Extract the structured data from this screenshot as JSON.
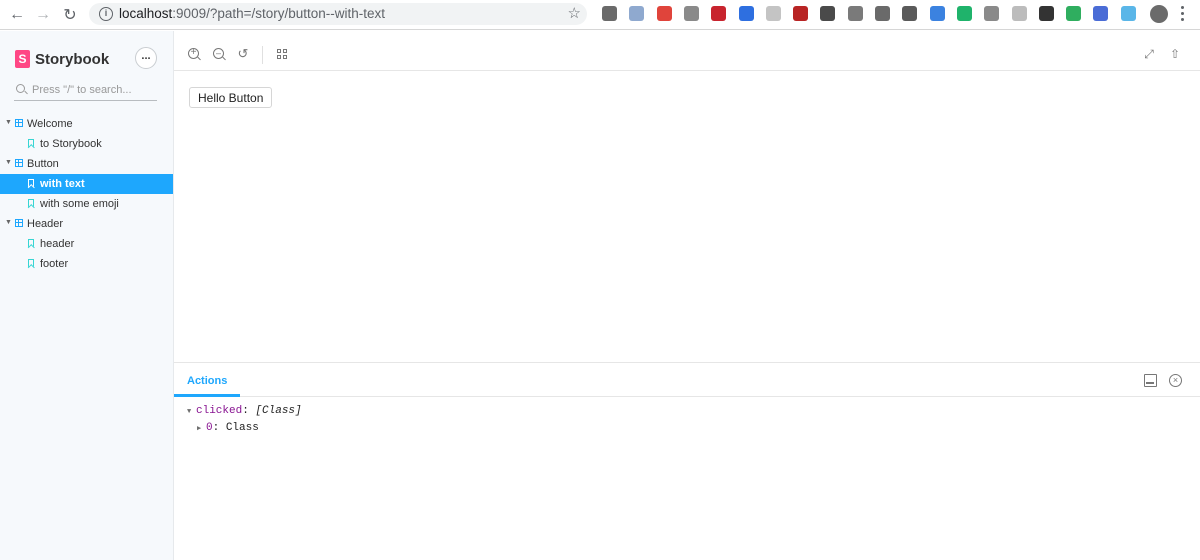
{
  "browser": {
    "url_host": "localhost",
    "url_rest": ":9009/?path=/story/button--with-text",
    "extensions": [
      {
        "name": "ext-1",
        "color": "#6a6a6a"
      },
      {
        "name": "ext-2",
        "color": "#8fa9cf"
      },
      {
        "name": "ext-3",
        "color": "#e0443b"
      },
      {
        "name": "ext-4",
        "color": "#8a8a8a"
      },
      {
        "name": "ext-5",
        "color": "#c8242e"
      },
      {
        "name": "ext-6",
        "color": "#2e6fe0"
      },
      {
        "name": "ext-7",
        "color": "#c4c4c4"
      },
      {
        "name": "ext-8",
        "color": "#b82424"
      },
      {
        "name": "ext-9",
        "color": "#4a4a4a"
      },
      {
        "name": "ext-10",
        "color": "#7a7a7a"
      },
      {
        "name": "ext-11",
        "color": "#6a6a6a"
      },
      {
        "name": "ext-12",
        "color": "#5a5a5a"
      },
      {
        "name": "ext-13",
        "color": "#3b82e0"
      },
      {
        "name": "ext-14",
        "color": "#1fb36b"
      },
      {
        "name": "ext-15",
        "color": "#8a8a8a"
      },
      {
        "name": "ext-16",
        "color": "#bcbcbc"
      },
      {
        "name": "ext-17",
        "color": "#333333"
      },
      {
        "name": "ext-18",
        "color": "#2fae5f"
      },
      {
        "name": "ext-19",
        "color": "#4a6cd6"
      },
      {
        "name": "ext-20",
        "color": "#5ab6e8"
      }
    ]
  },
  "sidebar": {
    "brand": "Storybook",
    "brand_logo": "S",
    "search_placeholder": "Press \"/\" to search...",
    "tree": [
      {
        "type": "kind",
        "label": "Welcome"
      },
      {
        "type": "story",
        "label": "to Storybook",
        "selected": false
      },
      {
        "type": "kind",
        "label": "Button"
      },
      {
        "type": "story",
        "label": "with text",
        "selected": true
      },
      {
        "type": "story",
        "label": "with some emoji",
        "selected": false
      },
      {
        "type": "kind",
        "label": "Header"
      },
      {
        "type": "story",
        "label": "header",
        "selected": false
      },
      {
        "type": "story",
        "label": "footer",
        "selected": false
      }
    ]
  },
  "preview": {
    "button_label": "Hello Button"
  },
  "panel": {
    "tab_label": "Actions",
    "log": {
      "key": "clicked",
      "value": "[Class]",
      "child_key": "0",
      "child_value": "Class"
    }
  },
  "colors": {
    "accent": "#1ea7fd",
    "brand": "#ff4785",
    "story_icon": "#37d5d3",
    "sidebar_bg": "#f6f9fc"
  }
}
